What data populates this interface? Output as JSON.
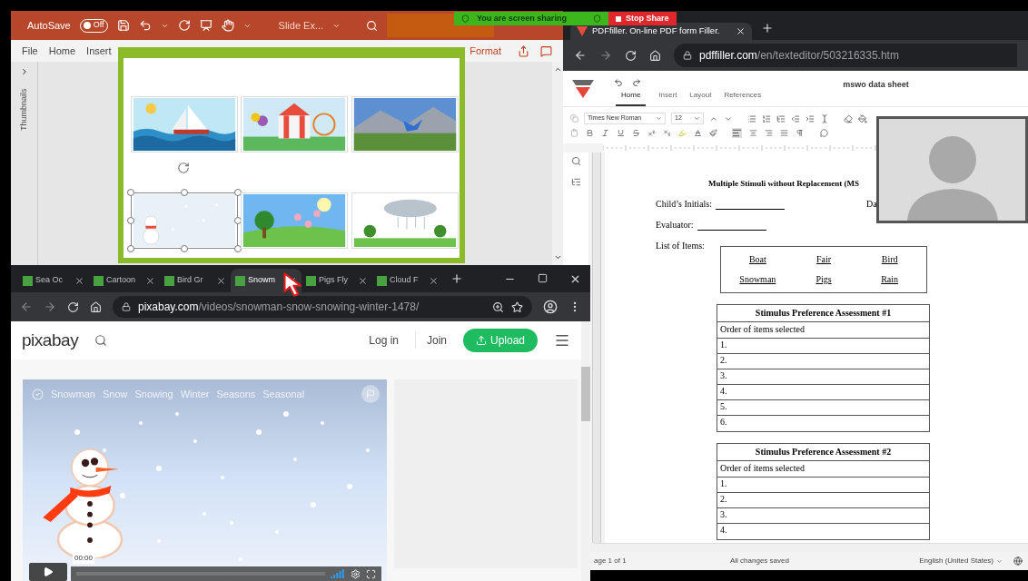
{
  "share_banner": {
    "message": "You are screen sharing",
    "stop_label": "Stop Share"
  },
  "powerpoint": {
    "autosave_label": "AutoSave",
    "autosave": {
      "on": false,
      "label": "Off"
    },
    "file_name": "Slide Ex...",
    "menu": [
      {
        "label": "File",
        "kind": "tab"
      },
      {
        "label": "Home",
        "kind": "tab"
      },
      {
        "label": "Insert",
        "kind": "tab"
      },
      {
        "label": "Format",
        "kind": "contextual"
      }
    ],
    "sidebar_label": "Thumbnails",
    "slides": [
      {
        "kind": "sailboat",
        "selected": false
      },
      {
        "kind": "fair",
        "selected": false
      },
      {
        "kind": "bird",
        "selected": false
      },
      {
        "kind": "snowman",
        "selected": true
      },
      {
        "kind": "pigs",
        "selected": false
      },
      {
        "kind": "rain",
        "selected": false
      }
    ]
  },
  "pixabay_browser": {
    "tabs": [
      {
        "label": "Sea Oc",
        "selected": false
      },
      {
        "label": "Cartoon",
        "selected": false
      },
      {
        "label": "Bird Gr",
        "selected": false
      },
      {
        "label": "Snowm",
        "selected": true
      },
      {
        "label": "Pigs Fly",
        "selected": false
      },
      {
        "label": "Cloud F",
        "selected": false
      }
    ],
    "url_host": "pixabay.com",
    "url_path": "/videos/snowman-snow-snowing-winter-1478/",
    "logo": "pixabay",
    "login": "Log in",
    "join": "Join",
    "upload": "Upload",
    "video": {
      "tags": [
        "Snowman",
        "Snow",
        "Snowing",
        "Winter",
        "Seasons",
        "Seasonal"
      ],
      "time": "00:00"
    }
  },
  "pdf_browser": {
    "tab_title": "PDFfiller. On-line PDF form Filler.",
    "url_host": "pdffiller.com",
    "url_path": "/en/texteditor/503216335.htm",
    "editor_tabs": [
      {
        "label": "Home",
        "selected": true
      },
      {
        "label": "Insert",
        "selected": false
      },
      {
        "label": "Layout",
        "selected": false
      },
      {
        "label": "References",
        "selected": false
      }
    ],
    "document_name": "mswo data sheet",
    "font": "Times New Roman",
    "font_size": "12",
    "document": {
      "title": "Multiple Stimuli without Replacement (MS",
      "fields": [
        {
          "label": "Child’s Initials:"
        },
        {
          "label": "Evaluator:"
        }
      ],
      "date_label": "Da",
      "list_label": "List of Items:",
      "items": [
        "Boat",
        "Fair",
        "Bird",
        "Snowman",
        "Pigs",
        "Rain"
      ],
      "tables": [
        {
          "title": "Stimulus Preference Assessment #1",
          "subtitle": "Order of items selected",
          "rows": [
            "1.",
            "2.",
            "3.",
            "4.",
            "5.",
            "6."
          ]
        },
        {
          "title": "Stimulus Preference Assessment #2",
          "subtitle": "Order of items selected",
          "rows": [
            "1.",
            "2.",
            "3.",
            "4."
          ]
        }
      ]
    },
    "status": {
      "page": "age 1 of 1",
      "saved": "All changes saved",
      "language": "English (United States)"
    }
  }
}
